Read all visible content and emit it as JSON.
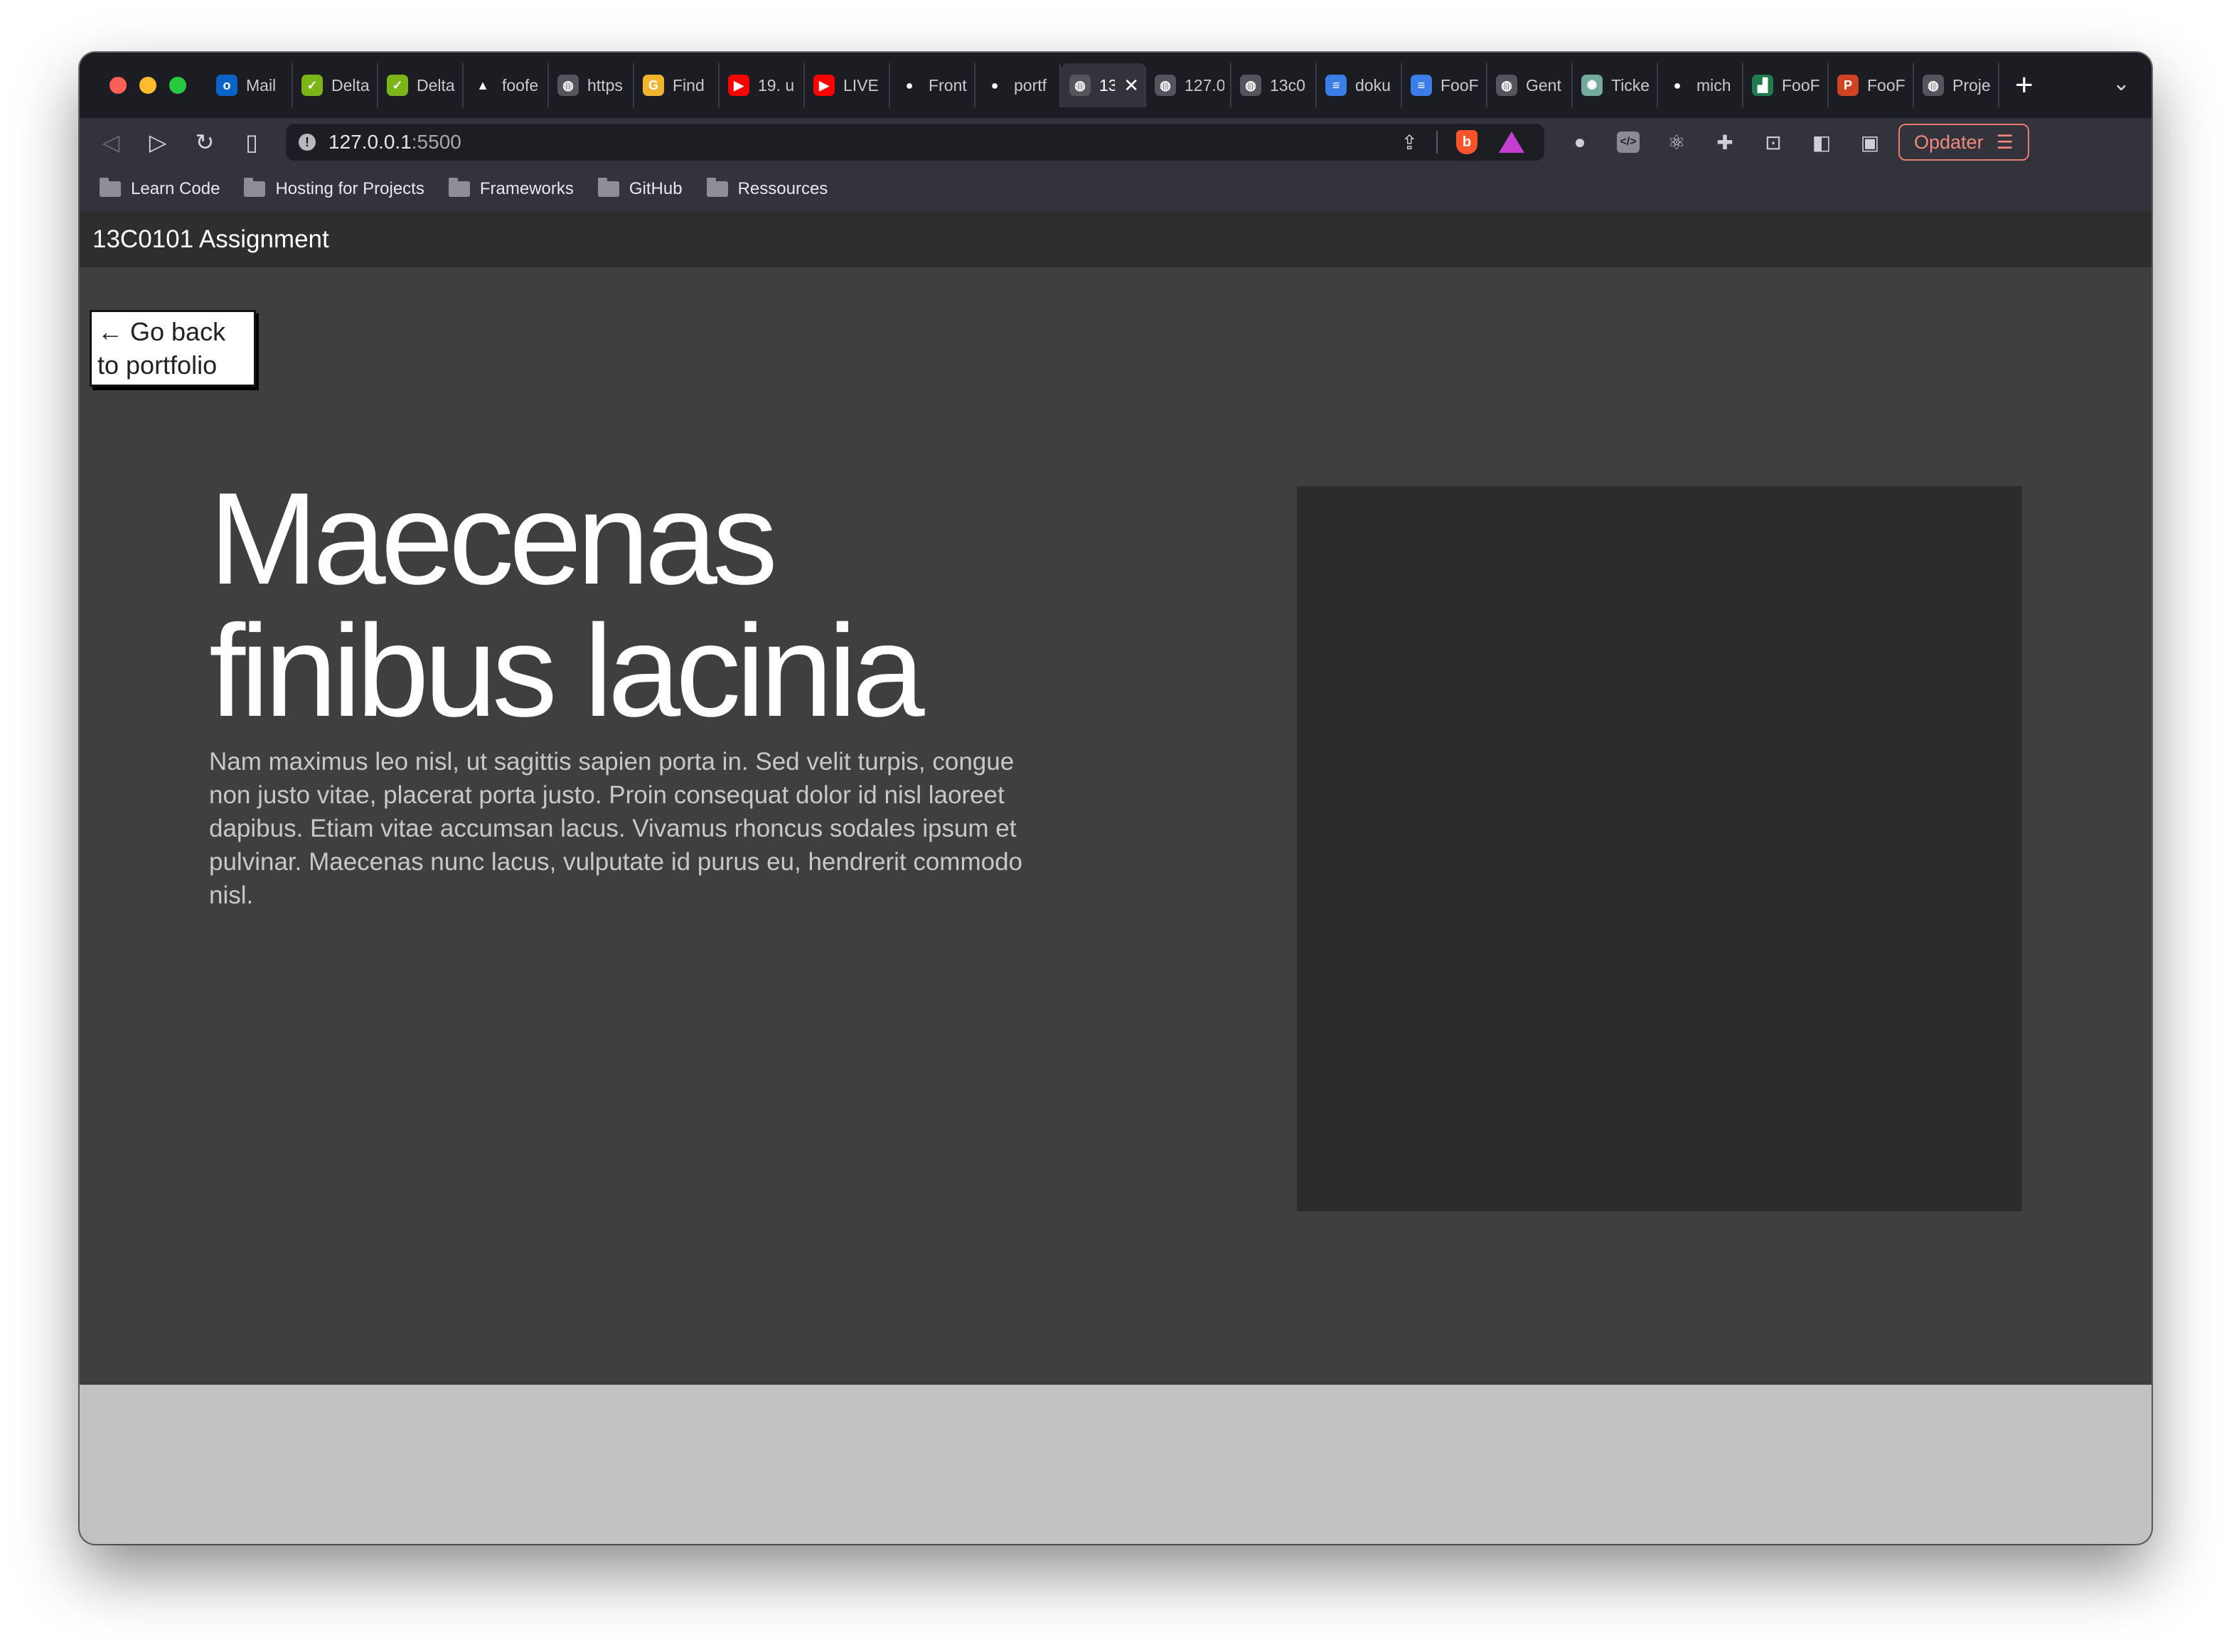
{
  "browser": {
    "tabs": [
      {
        "label": "Mail",
        "icon": "outlook-icon",
        "color": "#0a64c8",
        "glyph": "o"
      },
      {
        "label": "Delta",
        "icon": "delta-icon",
        "color": "#7cb518",
        "glyph": "✓"
      },
      {
        "label": "Delta",
        "icon": "delta-icon",
        "color": "#7cb518",
        "glyph": "✓"
      },
      {
        "label": "foofe",
        "icon": "vercel-icon",
        "color": "#1c1d22",
        "glyph": "▲"
      },
      {
        "label": "https",
        "icon": "globe-icon",
        "color": "#55565d",
        "glyph": "◍"
      },
      {
        "label": "Find",
        "icon": "google-icon",
        "color": "#f2b42f",
        "glyph": "G"
      },
      {
        "label": "19. u",
        "icon": "youtube-icon",
        "color": "#ff0000",
        "glyph": "▶"
      },
      {
        "label": "LIVE",
        "icon": "youtube-icon",
        "color": "#ff0000",
        "glyph": "▶"
      },
      {
        "label": "Front",
        "icon": "github-icon",
        "color": "#1c1d22",
        "glyph": "●"
      },
      {
        "label": "portf",
        "icon": "github-icon",
        "color": "#1c1d22",
        "glyph": "●"
      },
      {
        "label": "13",
        "icon": "globe-icon",
        "color": "#55565d",
        "glyph": "◍",
        "active": true
      },
      {
        "label": "127.0",
        "icon": "globe-icon",
        "color": "#55565d",
        "glyph": "◍"
      },
      {
        "label": "13c0",
        "icon": "globe-icon",
        "color": "#55565d",
        "glyph": "◍"
      },
      {
        "label": "doku",
        "icon": "docs-icon",
        "color": "#3b7ee8",
        "glyph": "≡"
      },
      {
        "label": "FooF",
        "icon": "docs-icon",
        "color": "#3b7ee8",
        "glyph": "≡"
      },
      {
        "label": "Gent",
        "icon": "globe-icon",
        "color": "#55565d",
        "glyph": "◍"
      },
      {
        "label": "Ticke",
        "icon": "chatgpt-icon",
        "color": "#74aa9c",
        "glyph": "✺"
      },
      {
        "label": "mich",
        "icon": "github-icon",
        "color": "#1c1d22",
        "glyph": "●"
      },
      {
        "label": "FooF",
        "icon": "chart-icon",
        "color": "#1f7a4d",
        "glyph": "▟"
      },
      {
        "label": "FooF",
        "icon": "powerpoint-icon",
        "color": "#d04423",
        "glyph": "P"
      },
      {
        "label": "Proje",
        "icon": "globe-icon",
        "color": "#55565d",
        "glyph": "◍"
      }
    ],
    "url_host": "127.0.0.1",
    "url_port": ":5500",
    "update_label": "Opdater",
    "bookmarks": [
      "Learn Code",
      "Hosting for Projects",
      "Frameworks",
      "GitHub",
      "Ressources"
    ]
  },
  "site": {
    "title": "13C0101 Assignment",
    "back_button": "← Go back to portfolio",
    "hero_title_line1": "Maecenas",
    "hero_title_line2": "finibus lacinia",
    "hero_text": "Nam maximus leo nisl, ut sagittis sapien porta in. Sed velit turpis, congue non justo vitae, placerat porta justo. Proin consequat dolor id nisl laoreet dapibus. Etiam vitae accumsan lacus. Vivamus rhoncus sodales ipsum et pulvinar. Maecenas nunc lacus, vulputate id purus eu, hendrerit commodo nisl."
  },
  "colors": {
    "page_background": "#3f3f3f",
    "header_background": "#2e2e2e",
    "image_placeholder": "#2c2c2c",
    "footer": "#c2c2c2",
    "accent_update": "#f08a7e"
  }
}
